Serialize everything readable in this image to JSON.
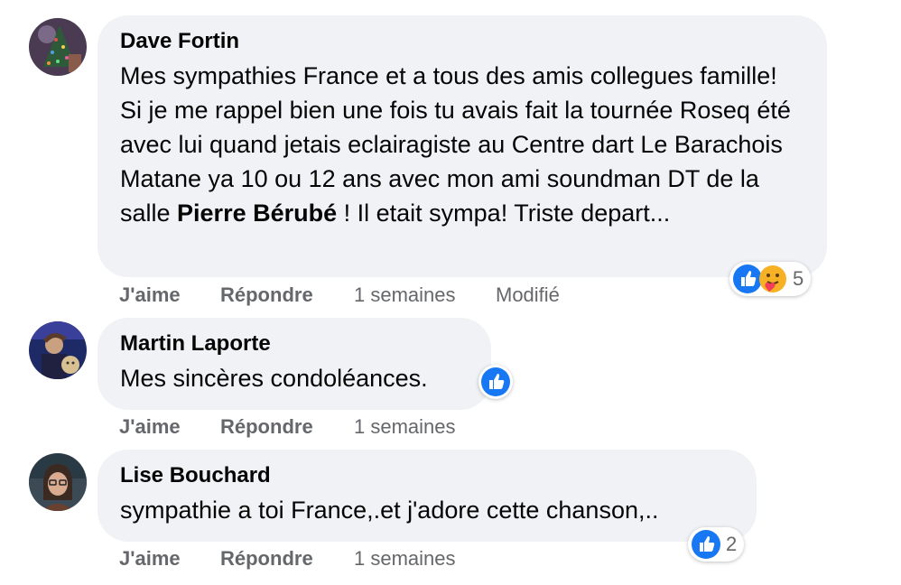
{
  "comments": [
    {
      "author": "Dave Fortin",
      "text_before": "Mes sympathies France et a tous des amis collegues famille! Si je me rappel bien une fois tu avais fait la tournée Roseq été avec lui quand jetais eclairagiste au Centre dart Le Barachois Matane ya 10 ou 12 ans avec mon ami soundman DT de la salle ",
      "mention": "Pierre Bérubé",
      "text_after": " ! Il etait sympa! Triste depart...",
      "actions": {
        "like": "J'aime",
        "reply": "Répondre",
        "time": "1 semaines",
        "edited": "Modifié"
      },
      "reactions": {
        "icons": [
          "like-icon",
          "care-icon"
        ],
        "count": "5"
      }
    },
    {
      "author": "Martin Laporte",
      "text": "Mes sincères condoléances.",
      "actions": {
        "like": "J'aime",
        "reply": "Répondre",
        "time": "1 semaines"
      },
      "reactions": {
        "icons": [
          "like-icon"
        ]
      }
    },
    {
      "author": "Lise Bouchard",
      "text": "sympathie a toi France,.et j'adore cette chanson,..",
      "actions": {
        "like": "J'aime",
        "reply": "Répondre",
        "time": "1 semaines"
      },
      "reactions": {
        "icons": [
          "like-icon"
        ],
        "count": "2"
      }
    }
  ],
  "colors": {
    "bubble": "#f0f2f5",
    "like_blue": "#1877f2",
    "meta_gray": "#65676b",
    "text": "#050505"
  }
}
